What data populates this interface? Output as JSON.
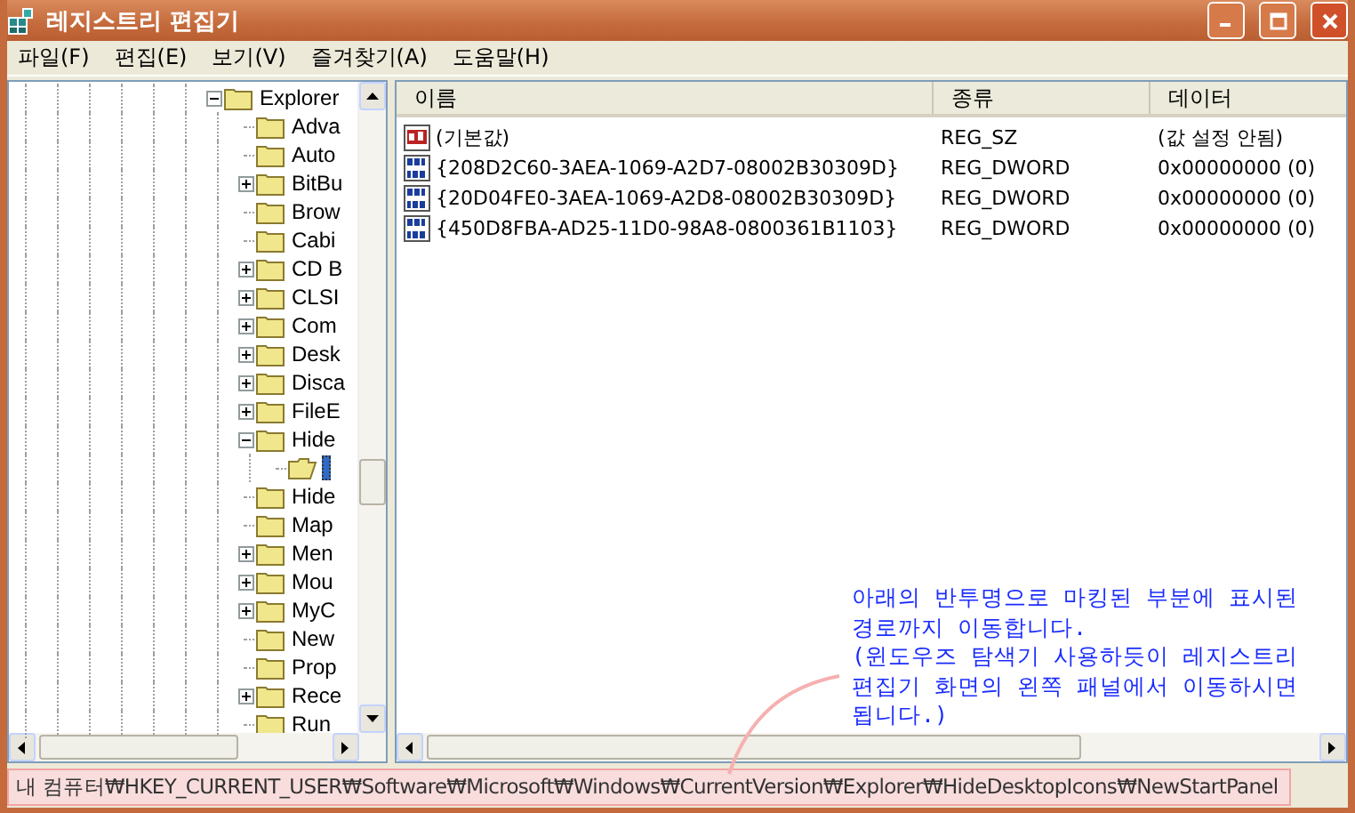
{
  "window": {
    "title": "레지스트리 편집기"
  },
  "menu": [
    {
      "label": "파일(F)"
    },
    {
      "label": "편집(E)"
    },
    {
      "label": "보기(V)"
    },
    {
      "label": "즐겨찾기(A)"
    },
    {
      "label": "도움말(H)"
    }
  ],
  "tree": [
    {
      "label": "Explorer",
      "expanded": true,
      "selected": false,
      "children": [
        {
          "label": "Adva",
          "selected": false
        },
        {
          "label": "Auto",
          "selected": false
        },
        {
          "label": "BitBu",
          "expanded": false,
          "selected": false
        },
        {
          "label": "Brow",
          "selected": false
        },
        {
          "label": "Cabi",
          "selected": false
        },
        {
          "label": "CD B",
          "expanded": false,
          "selected": false
        },
        {
          "label": "CLSI",
          "expanded": false,
          "selected": false
        },
        {
          "label": "Com",
          "expanded": false,
          "selected": false
        },
        {
          "label": "Desk",
          "expanded": false,
          "selected": false
        },
        {
          "label": "Disca",
          "expanded": false,
          "selected": false
        },
        {
          "label": "FileE",
          "expanded": false,
          "selected": false
        },
        {
          "label": "Hide",
          "expanded": true,
          "selected": false,
          "children": [
            {
              "selected": true
            }
          ]
        },
        {
          "label": "Hide",
          "selected": false
        },
        {
          "label": "Map",
          "selected": false
        },
        {
          "label": "Men",
          "expanded": false,
          "selected": false
        },
        {
          "label": "Mou",
          "expanded": false,
          "selected": false
        },
        {
          "label": "MyC",
          "expanded": false,
          "selected": false
        },
        {
          "label": "New",
          "selected": false
        },
        {
          "label": "Prop",
          "selected": false
        },
        {
          "label": "Rece",
          "expanded": false,
          "selected": false
        },
        {
          "label": "Run",
          "selected": false
        }
      ]
    }
  ],
  "table": {
    "columns": [
      "이름",
      "종류",
      "데이터"
    ],
    "rows": [
      {
        "kind": "string",
        "name": "(기본값)",
        "type": "REG_SZ",
        "data": "(값 설정 안됨)"
      },
      {
        "kind": "dword",
        "name": "{208D2C60-3AEA-1069-A2D7-08002B30309D}",
        "type": "REG_DWORD",
        "data": "0x00000000 (0)"
      },
      {
        "kind": "dword",
        "name": "{20D04FE0-3AEA-1069-A2D8-08002B30309D}",
        "type": "REG_DWORD",
        "data": "0x00000000 (0)"
      },
      {
        "kind": "dword",
        "name": "{450D8FBA-AD25-11D0-98A8-0800361B1103}",
        "type": "REG_DWORD",
        "data": "0x00000000 (0)"
      }
    ]
  },
  "annotation": {
    "lines": [
      "아래의 반투명으로 마킹된 부분에 표시된",
      "경로까지 이동합니다.",
      "(윈도우즈 탐색기 사용하듯이 레지스트리",
      "편집기 화면의 왼쪽 패널에서 이동하시면",
      "됩니다.)"
    ]
  },
  "status_bar": {
    "path": "내 컴퓨터₩HKEY_CURRENT_USER₩Software₩Microsoft₩Windows₩CurrentVersion₩Explorer₩HideDesktopIcons₩NewStartPanel"
  }
}
